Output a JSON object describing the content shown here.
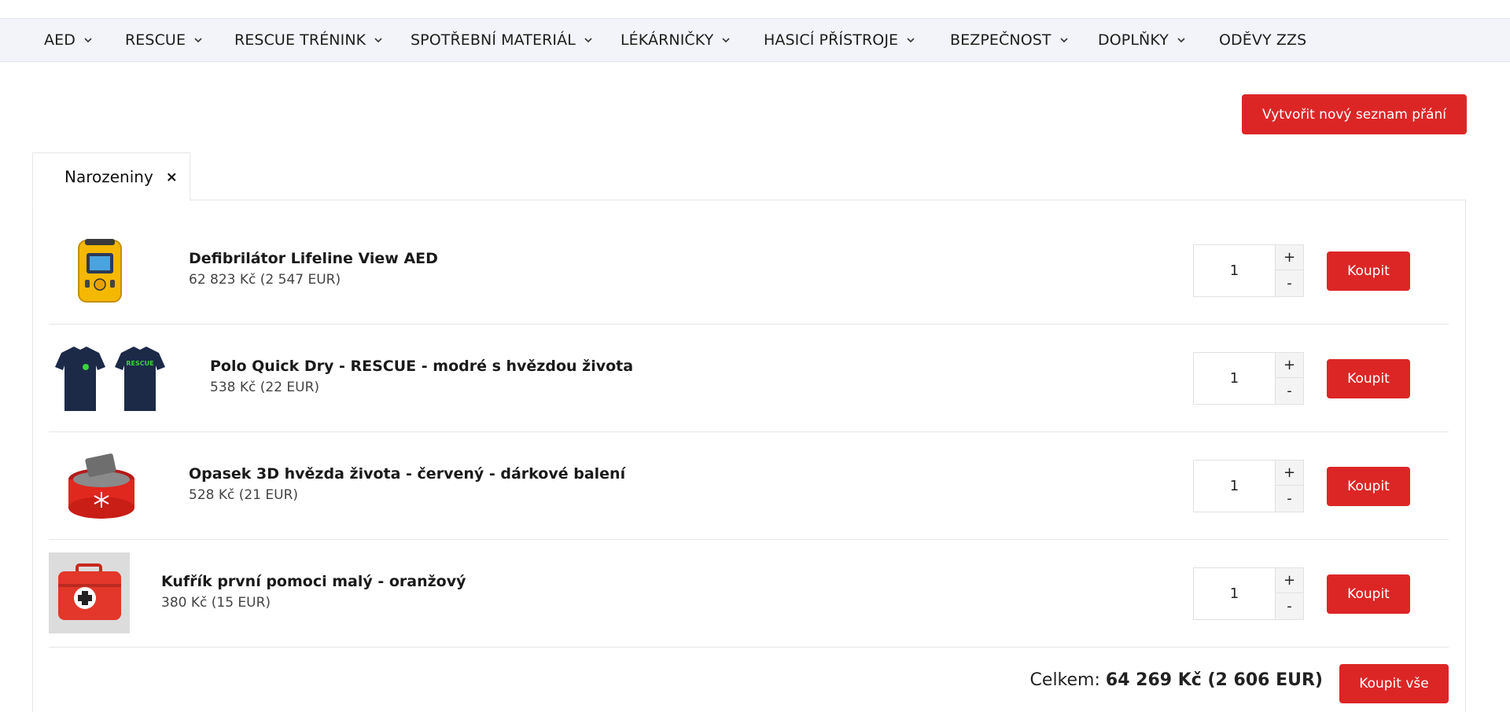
{
  "nav": {
    "items": [
      {
        "label": "AED",
        "has_dropdown": true
      },
      {
        "label": "RESCUE",
        "has_dropdown": true
      },
      {
        "label": "RESCUE TRÉNINK",
        "has_dropdown": true
      },
      {
        "label": "SPOTŘEBNÍ MATERIÁL",
        "has_dropdown": true
      },
      {
        "label": "LÉKÁRNIČKY",
        "has_dropdown": true
      },
      {
        "label": "HASICÍ PŘÍSTROJE",
        "has_dropdown": true
      },
      {
        "label": "BEZPEČNOST",
        "has_dropdown": true
      },
      {
        "label": "DOPLŇKY",
        "has_dropdown": true
      },
      {
        "label": "ODĚVY ZZS",
        "has_dropdown": false
      }
    ]
  },
  "create_wishlist_label": "Vytvořit nový seznam přání",
  "wishlist": {
    "tab_label": "Narozeniny",
    "close_glyph": "×",
    "items": [
      {
        "name": "Defibrilátor Lifeline View AED",
        "price": "62 823 Kč (2 547 EUR)",
        "qty": "1",
        "buy_label": "Koupit",
        "image": "defibrillator-icon"
      },
      {
        "name": "Polo Quick Dry - RESCUE - modré s hvězdou života",
        "price": "538 Kč (22 EUR)",
        "qty": "1",
        "buy_label": "Koupit",
        "image": "polo-shirt-icon"
      },
      {
        "name": "Opasek 3D hvězda života - červený - dárkové balení",
        "price": "528 Kč (21 EUR)",
        "qty": "1",
        "buy_label": "Koupit",
        "image": "belt-gift-box-icon"
      },
      {
        "name": "Kufřík první pomoci malý - oranžový",
        "price": "380 Kč (15 EUR)",
        "qty": "1",
        "buy_label": "Koupit",
        "image": "first-aid-case-icon"
      }
    ],
    "qty_plus": "+",
    "qty_minus": "-",
    "total_label": "Celkem:",
    "total_value": "64 269 Kč (2 606 EUR)",
    "buy_all_label": "Koupit vše"
  },
  "polo_print_text": "RESCUE",
  "colors": {
    "accent": "#dc2626",
    "nav_bg": "#f2f4f9"
  }
}
